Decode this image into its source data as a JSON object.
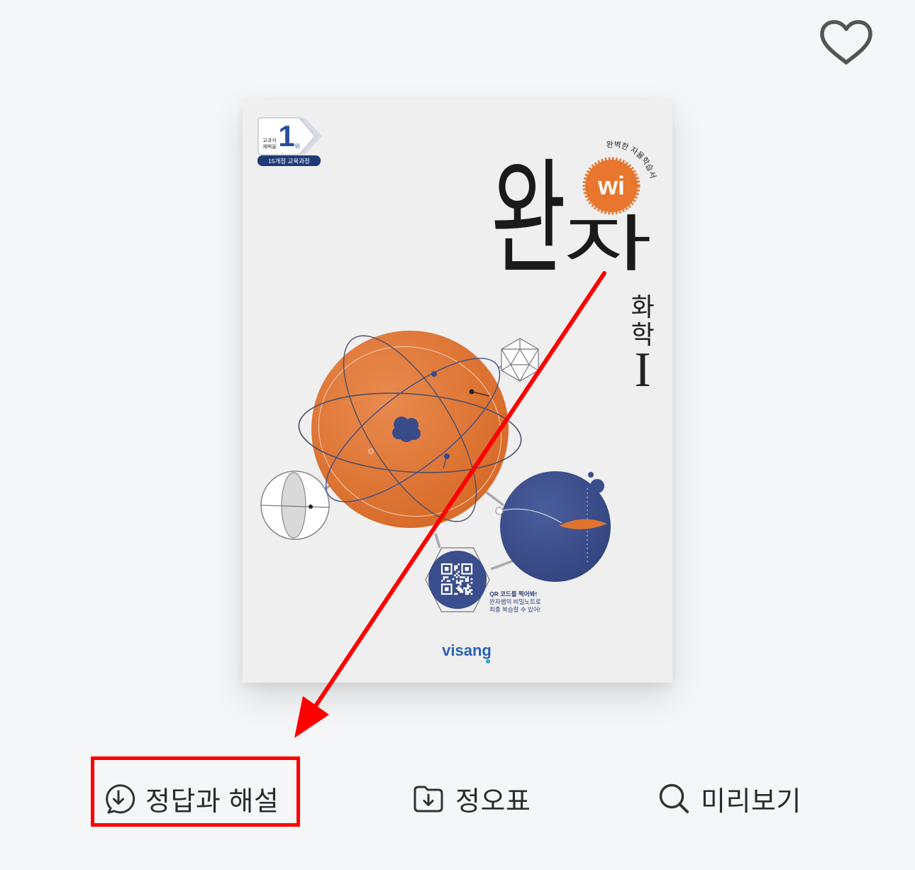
{
  "page": {
    "background": "#f5f6f8"
  },
  "favorite": {
    "icon": "heart-outline-icon",
    "color": "#555555"
  },
  "book": {
    "cover": {
      "badge": {
        "line1": "교과서",
        "line2": "채택율",
        "rank": "1",
        "rank_suffix": "위",
        "curriculum": "15개정 교육과정"
      },
      "tagline": "완벽한 자율학습서",
      "title": [
        "완",
        "자"
      ],
      "logo": "wi",
      "subject": [
        "화",
        "학"
      ],
      "level": "I",
      "qr_note": [
        "QR 코드를 찍어봐!",
        "완자쌤의 비밀노트로",
        "최종 복습할 수 있어!"
      ],
      "publisher": "visang",
      "colors": {
        "background": "#efefef",
        "orange": "#e0742f",
        "navy": "#3a4d8c",
        "publisher_blue": "#2a62b8"
      }
    }
  },
  "actions": [
    {
      "label": "정답과 해설",
      "icon": "download-circle-icon"
    },
    {
      "label": "정오표",
      "icon": "folder-download-icon"
    },
    {
      "label": "미리보기",
      "icon": "search-icon"
    }
  ],
  "annotation": {
    "color": "#ff0000",
    "highlighted_action": "정답과 해설"
  }
}
